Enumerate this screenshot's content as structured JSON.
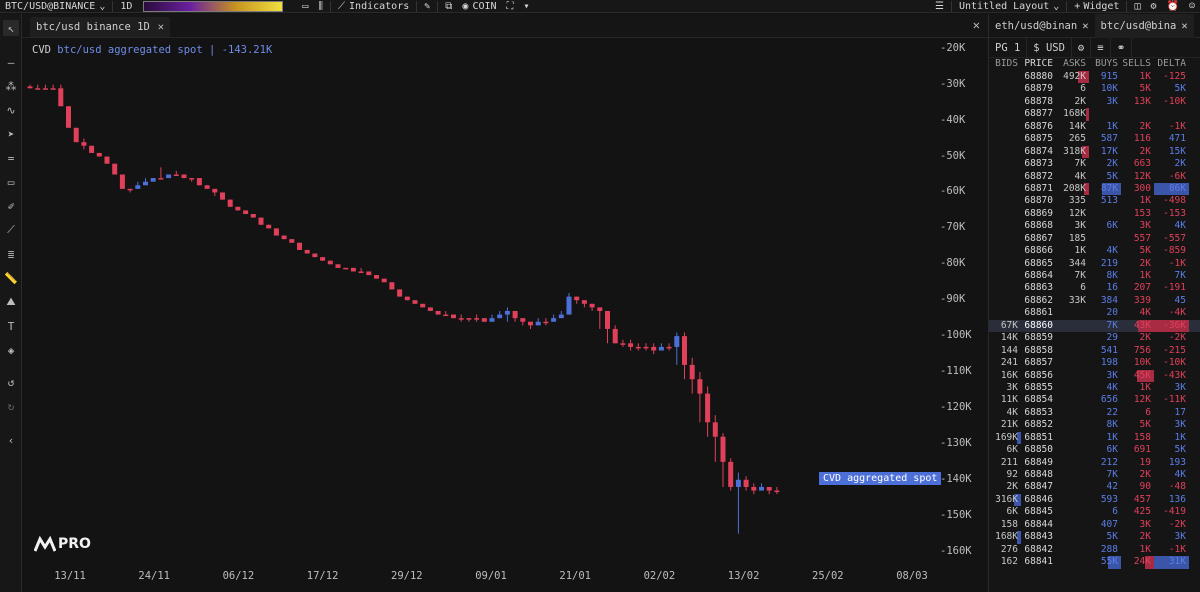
{
  "topbar": {
    "symbol": "BTC/USD@BINANCE",
    "interval": "1D",
    "indicators_label": "Indicators",
    "coin_label": "COIN",
    "layout_label": "Untitled Layout",
    "widget_label": "Widget"
  },
  "chart_tab": {
    "title": "btc/usd binance 1D"
  },
  "chart": {
    "indicator_name": "CVD",
    "indicator_sub": "btc/usd aggregated spot",
    "indicator_value": "-143.21K",
    "series_tag": "CVD aggregated spot",
    "logo_text": "PRO",
    "colors": {
      "up": "#4d6fd8",
      "down": "#e0405a"
    }
  },
  "chart_data": {
    "type": "candlestick",
    "title": "CVD btc/usd aggregated spot",
    "y_ticks": [
      "-20K",
      "-30K",
      "-40K",
      "-50K",
      "-60K",
      "-70K",
      "-80K",
      "-90K",
      "-100K",
      "-110K",
      "-120K",
      "-130K",
      "-140K",
      "-150K",
      "-160K"
    ],
    "x_ticks": [
      "13/11",
      "24/11",
      "06/12",
      "17/12",
      "29/12",
      "09/01",
      "21/01",
      "02/02",
      "13/02",
      "25/02",
      "08/03"
    ],
    "ylim": [
      -164,
      -17
    ],
    "closes": [
      -31,
      -31,
      -31,
      -31,
      -36,
      -42,
      -46,
      -47,
      -49,
      -50,
      -52,
      -55,
      -59,
      -59,
      -58,
      -57,
      -56,
      -56,
      -55,
      -55,
      -56,
      -56,
      -58,
      -59,
      -60,
      -62,
      -64,
      -65,
      -66,
      -67,
      -69,
      -70,
      -72,
      -73,
      -74,
      -76,
      -77,
      -78,
      -79,
      -80,
      -81,
      -81,
      -82,
      -82,
      -83,
      -84,
      -85,
      -87,
      -89,
      -90,
      -91,
      -92,
      -93,
      -94,
      -94,
      -95,
      -95,
      -95,
      -95,
      -96,
      -95,
      -94,
      -93,
      -95,
      -96,
      -97,
      -96,
      -96,
      -95,
      -94,
      -89,
      -90,
      -91,
      -92,
      -93,
      -98,
      -102,
      -102,
      -103,
      -103,
      -103,
      -104,
      -103,
      -103,
      -100,
      -108,
      -112,
      -116,
      -124,
      -128,
      -135,
      -142,
      -140,
      -142,
      -143,
      -142,
      -143,
      -143
    ],
    "wick_high": [
      -30,
      -30,
      -30,
      -30,
      -30,
      -36,
      -42,
      -45,
      -47,
      -49,
      -50,
      -52,
      -55,
      -59,
      -57,
      -56,
      -56,
      -53,
      -55,
      -54,
      -55,
      -56,
      -56,
      -58,
      -59,
      -60,
      -62,
      -64,
      -65,
      -66,
      -67,
      -69,
      -70,
      -72,
      -73,
      -74,
      -76,
      -77,
      -78,
      -79,
      -80,
      -81,
      -81,
      -81,
      -82,
      -83,
      -84,
      -85,
      -87,
      -89,
      -90,
      -91,
      -92,
      -93,
      -93,
      -94,
      -94,
      -95,
      -94,
      -95,
      -94,
      -93,
      -92,
      -94,
      -95,
      -96,
      -95,
      -95,
      -94,
      -93,
      -88,
      -89,
      -90,
      -91,
      -92,
      -93,
      -97,
      -101,
      -101,
      -102,
      -102,
      -102,
      -102,
      -102,
      -99,
      -99,
      -106,
      -110,
      -114,
      -122,
      -127,
      -134,
      -138,
      -139,
      -141,
      -141,
      -142,
      -142
    ],
    "wick_low": [
      -31,
      -31,
      -31,
      -31,
      -36,
      -42,
      -46,
      -48,
      -49,
      -50,
      -52,
      -55,
      -59,
      -60,
      -58,
      -57,
      -56,
      -56,
      -55,
      -55,
      -56,
      -57,
      -58,
      -59,
      -61,
      -62,
      -64,
      -65,
      -66,
      -67,
      -69,
      -70,
      -72,
      -73,
      -74,
      -76,
      -77,
      -78,
      -79,
      -80,
      -81,
      -81,
      -82,
      -82,
      -83,
      -84,
      -85,
      -87,
      -89,
      -90,
      -91,
      -92,
      -93,
      -94,
      -94,
      -95,
      -96,
      -96,
      -96,
      -96,
      -96,
      -95,
      -96,
      -96,
      -97,
      -98,
      -97,
      -97,
      -96,
      -95,
      -94,
      -91,
      -92,
      -93,
      -98,
      -102,
      -102,
      -103,
      -104,
      -104,
      -104,
      -105,
      -104,
      -104,
      -108,
      -112,
      -116,
      -124,
      -128,
      -135,
      -142,
      -143,
      -155,
      -143,
      -144,
      -143,
      -144,
      -144
    ]
  },
  "right_panel": {
    "tabs": [
      {
        "label": "eth/usd@binan"
      },
      {
        "label": "btc/usd@bina"
      }
    ],
    "page_label": "PG 1",
    "currency_label": "$ USD",
    "columns": [
      "BIDS",
      "PRICE",
      "ASKS",
      "BUYS",
      "SELLS",
      "DELTA"
    ],
    "mid_price": "68860",
    "rows": [
      {
        "bid": "",
        "price": "68880",
        "ask": "492K",
        "buy": "915",
        "sell": "1K",
        "delta": "-125",
        "askbar": 34,
        "buybar": 0,
        "sellbar": 0,
        "bidbar": 0,
        "dpos": false
      },
      {
        "bid": "",
        "price": "68879",
        "ask": "6",
        "buy": "10K",
        "sell": "5K",
        "delta": "5K",
        "askbar": 0,
        "buybar": 0,
        "sellbar": 0,
        "bidbar": 0,
        "dpos": true
      },
      {
        "bid": "",
        "price": "68878",
        "ask": "2K",
        "buy": "3K",
        "sell": "13K",
        "delta": "-10K",
        "askbar": 0,
        "buybar": 0,
        "sellbar": 0,
        "bidbar": 0,
        "dpos": false
      },
      {
        "bid": "",
        "price": "68877",
        "ask": "168K",
        "buy": "",
        "sell": "",
        "delta": "",
        "askbar": 10,
        "buybar": 0,
        "sellbar": 0,
        "bidbar": 0,
        "dpos": false
      },
      {
        "bid": "",
        "price": "68876",
        "ask": "14K",
        "buy": "1K",
        "sell": "2K",
        "delta": "-1K",
        "askbar": 0,
        "buybar": 0,
        "sellbar": 0,
        "bidbar": 0,
        "dpos": false
      },
      {
        "bid": "",
        "price": "68875",
        "ask": "265",
        "buy": "587",
        "sell": "116",
        "delta": "471",
        "askbar": 0,
        "buybar": 0,
        "sellbar": 0,
        "bidbar": 0,
        "dpos": true
      },
      {
        "bid": "",
        "price": "68874",
        "ask": "318K",
        "buy": "17K",
        "sell": "2K",
        "delta": "15K",
        "askbar": 22,
        "buybar": 0,
        "sellbar": 0,
        "bidbar": 0,
        "dpos": true
      },
      {
        "bid": "",
        "price": "68873",
        "ask": "7K",
        "buy": "2K",
        "sell": "663",
        "delta": "2K",
        "askbar": 0,
        "buybar": 0,
        "sellbar": 0,
        "bidbar": 0,
        "dpos": true
      },
      {
        "bid": "",
        "price": "68872",
        "ask": "4K",
        "buy": "5K",
        "sell": "12K",
        "delta": "-6K",
        "askbar": 0,
        "buybar": 0,
        "sellbar": 0,
        "bidbar": 0,
        "dpos": false
      },
      {
        "bid": "",
        "price": "68871",
        "ask": "208K",
        "buy": "87K",
        "sell": "300",
        "delta": "86K",
        "askbar": 14,
        "buybar": 60,
        "sellbar": 0,
        "bidbar": 0,
        "dpos": true
      },
      {
        "bid": "",
        "price": "68870",
        "ask": "335",
        "buy": "513",
        "sell": "1K",
        "delta": "-498",
        "askbar": 0,
        "buybar": 0,
        "sellbar": 0,
        "bidbar": 0,
        "dpos": false
      },
      {
        "bid": "",
        "price": "68869",
        "ask": "12K",
        "buy": "",
        "sell": "153",
        "delta": "-153",
        "askbar": 0,
        "buybar": 0,
        "sellbar": 0,
        "bidbar": 0,
        "dpos": false
      },
      {
        "bid": "",
        "price": "68868",
        "ask": "3K",
        "buy": "6K",
        "sell": "3K",
        "delta": "4K",
        "askbar": 0,
        "buybar": 0,
        "sellbar": 0,
        "bidbar": 0,
        "dpos": true
      },
      {
        "bid": "",
        "price": "68867",
        "ask": "185",
        "buy": "",
        "sell": "557",
        "delta": "-557",
        "askbar": 0,
        "buybar": 0,
        "sellbar": 0,
        "bidbar": 0,
        "dpos": false
      },
      {
        "bid": "",
        "price": "68866",
        "ask": "1K",
        "buy": "4K",
        "sell": "5K",
        "delta": "-859",
        "askbar": 0,
        "buybar": 0,
        "sellbar": 0,
        "bidbar": 0,
        "dpos": false
      },
      {
        "bid": "",
        "price": "68865",
        "ask": "344",
        "buy": "219",
        "sell": "2K",
        "delta": "-1K",
        "askbar": 0,
        "buybar": 0,
        "sellbar": 0,
        "bidbar": 0,
        "dpos": false
      },
      {
        "bid": "",
        "price": "68864",
        "ask": "7K",
        "buy": "8K",
        "sell": "1K",
        "delta": "7K",
        "askbar": 0,
        "buybar": 0,
        "sellbar": 0,
        "bidbar": 0,
        "dpos": true
      },
      {
        "bid": "",
        "price": "68863",
        "ask": "6",
        "buy": "16",
        "sell": "207",
        "delta": "-191",
        "askbar": 0,
        "buybar": 0,
        "sellbar": 0,
        "bidbar": 0,
        "dpos": false
      },
      {
        "bid": "",
        "price": "68862",
        "ask": "33K",
        "buy": "384",
        "sell": "339",
        "delta": "45",
        "askbar": 0,
        "buybar": 0,
        "sellbar": 0,
        "bidbar": 0,
        "dpos": true
      },
      {
        "bid": "",
        "price": "68861",
        "ask": "",
        "buy": "20",
        "sell": "4K",
        "delta": "-4K",
        "askbar": 0,
        "buybar": 0,
        "sellbar": 0,
        "bidbar": 0,
        "dpos": false
      },
      {
        "bid": "67K",
        "price": "68860",
        "ask": "",
        "buy": "7K",
        "sell": "43K",
        "delta": "-36K",
        "askbar": 0,
        "buybar": 0,
        "sellbar": 50,
        "bidbar": 0,
        "dpos": false,
        "mid": true
      },
      {
        "bid": "14K",
        "price": "68859",
        "ask": "",
        "buy": "29",
        "sell": "2K",
        "delta": "-2K",
        "askbar": 0,
        "buybar": 0,
        "sellbar": 0,
        "bidbar": 0,
        "dpos": false
      },
      {
        "bid": "144",
        "price": "68858",
        "ask": "",
        "buy": "541",
        "sell": "756",
        "delta": "-215",
        "askbar": 0,
        "buybar": 0,
        "sellbar": 0,
        "bidbar": 0,
        "dpos": false
      },
      {
        "bid": "241",
        "price": "68857",
        "ask": "",
        "buy": "198",
        "sell": "10K",
        "delta": "-10K",
        "askbar": 0,
        "buybar": 0,
        "sellbar": 0,
        "bidbar": 0,
        "dpos": false
      },
      {
        "bid": "16K",
        "price": "68856",
        "ask": "",
        "buy": "3K",
        "sell": "45K",
        "delta": "-43K",
        "askbar": 0,
        "buybar": 0,
        "sellbar": 52,
        "bidbar": 0,
        "dpos": false
      },
      {
        "bid": "3K",
        "price": "68855",
        "ask": "",
        "buy": "4K",
        "sell": "1K",
        "delta": "3K",
        "askbar": 0,
        "buybar": 0,
        "sellbar": 0,
        "bidbar": 0,
        "dpos": true
      },
      {
        "bid": "11K",
        "price": "68854",
        "ask": "",
        "buy": "656",
        "sell": "12K",
        "delta": "-11K",
        "askbar": 0,
        "buybar": 0,
        "sellbar": 0,
        "bidbar": 0,
        "dpos": false
      },
      {
        "bid": "4K",
        "price": "68853",
        "ask": "",
        "buy": "22",
        "sell": "6",
        "delta": "17",
        "askbar": 0,
        "buybar": 0,
        "sellbar": 0,
        "bidbar": 0,
        "dpos": true
      },
      {
        "bid": "21K",
        "price": "68852",
        "ask": "",
        "buy": "8K",
        "sell": "5K",
        "delta": "3K",
        "askbar": 0,
        "buybar": 0,
        "sellbar": 0,
        "bidbar": 0,
        "dpos": true
      },
      {
        "bid": "169K",
        "price": "68851",
        "ask": "",
        "buy": "1K",
        "sell": "158",
        "delta": "1K",
        "askbar": 0,
        "buybar": 0,
        "sellbar": 0,
        "bidbar": 12,
        "dpos": true
      },
      {
        "bid": "6K",
        "price": "68850",
        "ask": "",
        "buy": "6K",
        "sell": "691",
        "delta": "5K",
        "askbar": 0,
        "buybar": 0,
        "sellbar": 0,
        "bidbar": 0,
        "dpos": true
      },
      {
        "bid": "211",
        "price": "68849",
        "ask": "",
        "buy": "212",
        "sell": "19",
        "delta": "193",
        "askbar": 0,
        "buybar": 0,
        "sellbar": 0,
        "bidbar": 0,
        "dpos": true
      },
      {
        "bid": "92",
        "price": "68848",
        "ask": "",
        "buy": "7K",
        "sell": "2K",
        "delta": "4K",
        "askbar": 0,
        "buybar": 0,
        "sellbar": 0,
        "bidbar": 0,
        "dpos": true
      },
      {
        "bid": "2K",
        "price": "68847",
        "ask": "",
        "buy": "42",
        "sell": "90",
        "delta": "-48",
        "askbar": 0,
        "buybar": 0,
        "sellbar": 0,
        "bidbar": 0,
        "dpos": false
      },
      {
        "bid": "316K",
        "price": "68846",
        "ask": "",
        "buy": "593",
        "sell": "457",
        "delta": "136",
        "askbar": 0,
        "buybar": 0,
        "sellbar": 0,
        "bidbar": 22,
        "dpos": true
      },
      {
        "bid": "6K",
        "price": "68845",
        "ask": "",
        "buy": "6",
        "sell": "425",
        "delta": "-419",
        "askbar": 0,
        "buybar": 0,
        "sellbar": 0,
        "bidbar": 0,
        "dpos": false
      },
      {
        "bid": "158",
        "price": "68844",
        "ask": "",
        "buy": "407",
        "sell": "3K",
        "delta": "-2K",
        "askbar": 0,
        "buybar": 0,
        "sellbar": 0,
        "bidbar": 0,
        "dpos": false
      },
      {
        "bid": "168K",
        "price": "68843",
        "ask": "",
        "buy": "5K",
        "sell": "2K",
        "delta": "3K",
        "askbar": 0,
        "buybar": 0,
        "sellbar": 0,
        "bidbar": 12,
        "dpos": true
      },
      {
        "bid": "276",
        "price": "68842",
        "ask": "",
        "buy": "288",
        "sell": "1K",
        "delta": "-1K",
        "askbar": 0,
        "buybar": 0,
        "sellbar": 0,
        "bidbar": 0,
        "dpos": false
      },
      {
        "bid": "162",
        "price": "68841",
        "ask": "",
        "buy": "55K",
        "sell": "24K",
        "delta": "31K",
        "askbar": 0,
        "buybar": 40,
        "sellbar": 28,
        "bidbar": 0,
        "dpos": true
      }
    ]
  }
}
